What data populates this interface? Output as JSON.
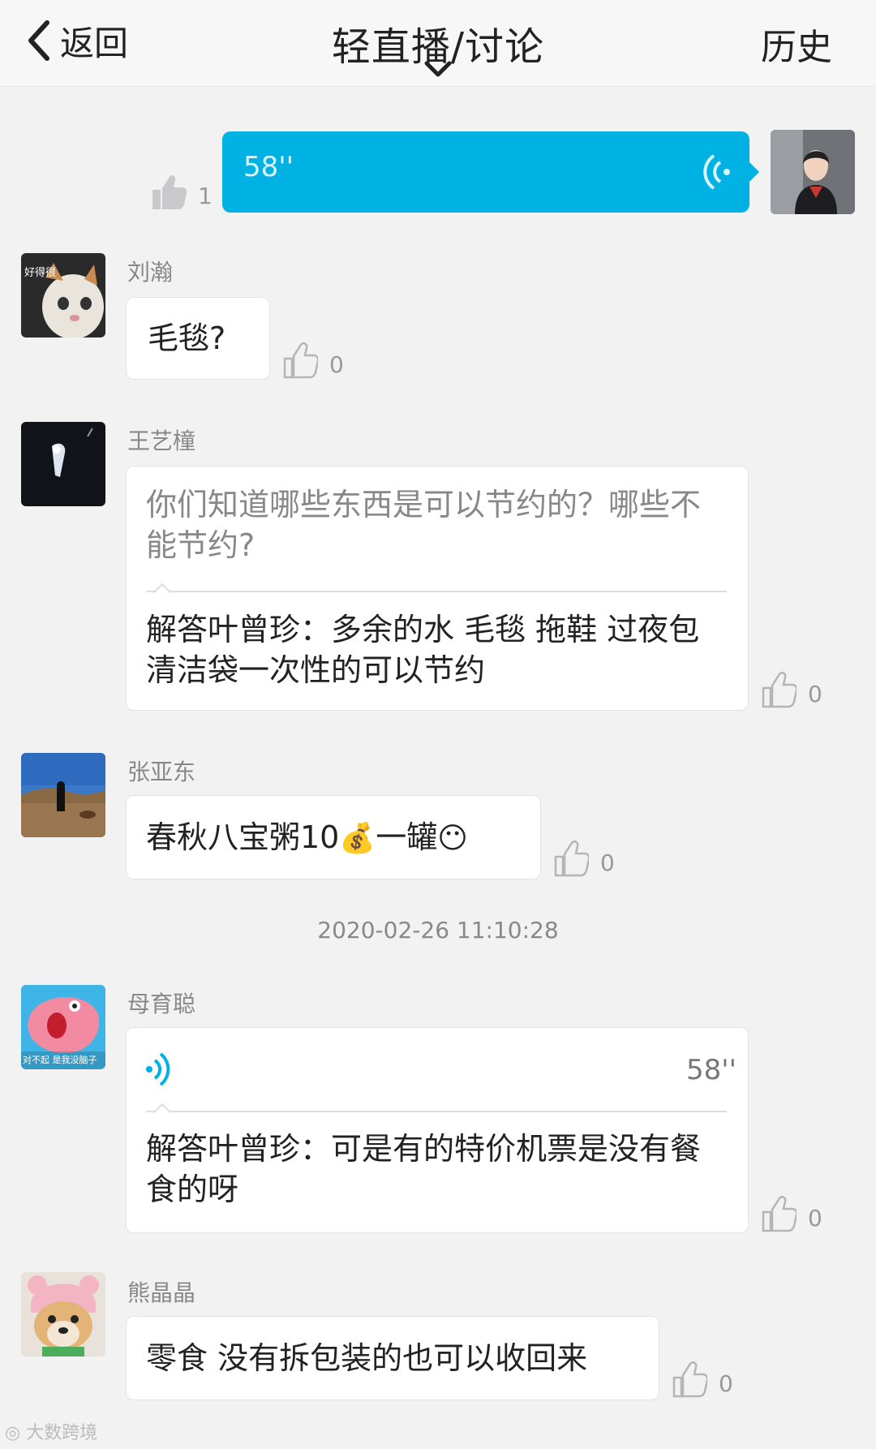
{
  "header": {
    "back_label": "返回",
    "title": "轻直播/讨论",
    "history_label": "历史"
  },
  "my_voice": {
    "duration": "58''",
    "like_count": "1"
  },
  "messages": [
    {
      "user": "刘瀚",
      "avatar_text": "好得很",
      "text": "毛毯?",
      "likes": "0"
    },
    {
      "user": "王艺橦",
      "question": "你们知道哪些东西是可以节约的？哪些不能节约?",
      "answer": "解答叶曾珍：多余的水 毛毯 拖鞋 过夜包 清洁袋一次性的可以节约",
      "likes": "0"
    },
    {
      "user": "张亚东",
      "text_before": "春秋八宝粥10",
      "money_emoji": "💰",
      "text_mid": "一罐",
      "face_emoji": "😶",
      "likes": "0"
    },
    {
      "user": "母育聪",
      "avatar_text": "对不起 是我没脑子",
      "voice_duration": "58''",
      "answer": "解答叶曾珍：可是有的特价机票是没有餐食的呀",
      "likes": "0"
    },
    {
      "user": "熊晶晶",
      "text": "零食 没有拆包装的也可以收回来",
      "likes": "0"
    }
  ],
  "timestamp": "2020-02-26 11:10:28",
  "watermark": "大数跨境",
  "colors": {
    "accent": "#00b2e3",
    "background": "#f2f2f3"
  }
}
